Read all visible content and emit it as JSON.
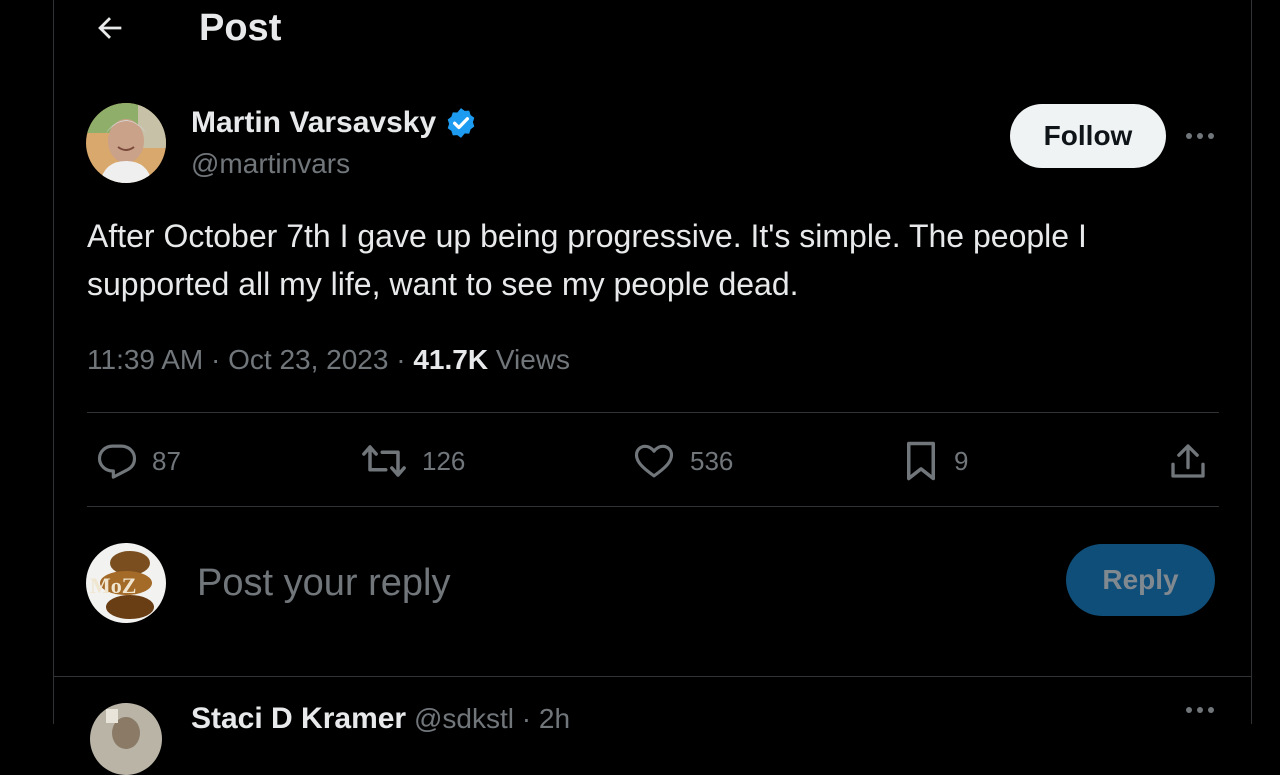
{
  "header": {
    "title": "Post",
    "back_icon": "arrow-left-icon"
  },
  "post": {
    "author_name": "Martin Varsavsky",
    "author_handle": "@martinvars",
    "verified": true,
    "follow_label": "Follow",
    "text": "After October 7th I gave up being progressive. It's simple. The people I supported all my life, want to see my people dead.",
    "time": "11:39 AM",
    "date": "Oct 23, 2023",
    "views_count": "41.7K",
    "views_label": "Views",
    "separator": "·",
    "stats": {
      "replies": "87",
      "reposts": "126",
      "likes": "536",
      "bookmarks": "9"
    }
  },
  "reply_box": {
    "avatar_text": "MoZ",
    "placeholder": "Post your reply",
    "button_label": "Reply"
  },
  "next_post": {
    "author_name": "Staci D Kramer",
    "author_handle": "@sdkstl",
    "separator": "·",
    "time": "2h"
  },
  "colors": {
    "background": "#000000",
    "text": "#e7e9ea",
    "muted": "#71767b",
    "border": "#2f3336",
    "verified": "#1d9bf0",
    "reply_button": "#0f4e78"
  }
}
